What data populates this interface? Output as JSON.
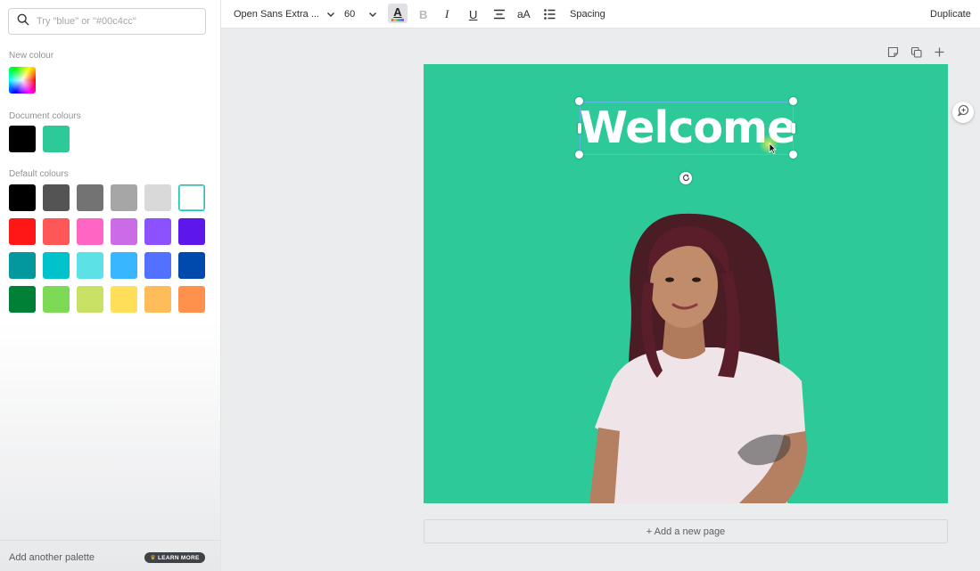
{
  "sidebar": {
    "search_placeholder": "Try \"blue\" or \"#00c4cc\"",
    "new_colour_label": "New colour",
    "document_colours_label": "Document colours",
    "document_colours": [
      "#000000",
      "#2ec998"
    ],
    "default_colours_label": "Default colours",
    "default_colours": [
      [
        "#000000",
        "#545454",
        "#737373",
        "#a6a6a6",
        "#d9d9d9",
        "#ffffff"
      ],
      [
        "#ff1616",
        "#ff5757",
        "#ff66c4",
        "#cb6ce6",
        "#8c52ff",
        "#5e17eb"
      ],
      [
        "#03989e",
        "#00c2cb",
        "#5ce1e6",
        "#38b6ff",
        "#5271ff",
        "#004aad"
      ],
      [
        "#008037",
        "#7ed957",
        "#c9e265",
        "#ffde59",
        "#ffbd59",
        "#ff914d"
      ]
    ],
    "add_palette_label": "Add another palette",
    "learn_more_label": "LEARN MORE"
  },
  "toolbar": {
    "font_name": "Open Sans Extra ...",
    "font_size": "60",
    "color_letter": "A",
    "bold": "B",
    "italic": "I",
    "underline": "U",
    "case_label": "aA",
    "spacing_label": "Spacing",
    "duplicate_label": "Duplicate"
  },
  "canvas": {
    "background_color": "#2ec998",
    "heading_text": "Welcome",
    "add_page_label": "+ Add a new page"
  }
}
